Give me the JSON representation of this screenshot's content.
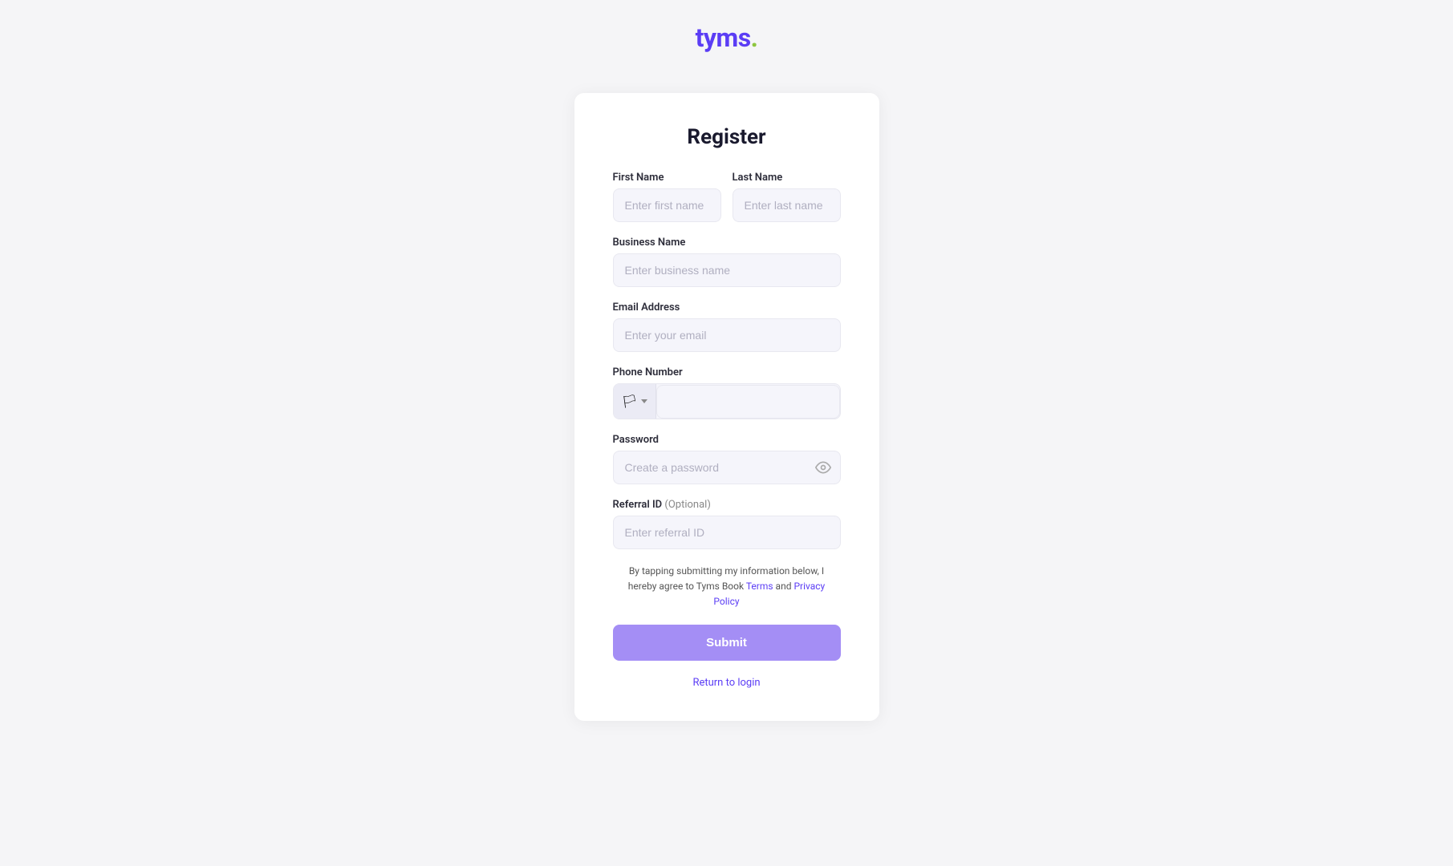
{
  "header": {
    "logo_text": "tyms",
    "logo_dot": "."
  },
  "form": {
    "title": "Register",
    "fields": {
      "first_name": {
        "label": "First Name",
        "placeholder": "Enter first name"
      },
      "last_name": {
        "label": "Last Name",
        "placeholder": "Enter last name"
      },
      "business_name": {
        "label": "Business Name",
        "placeholder": "Enter business name"
      },
      "email": {
        "label": "Email Address",
        "placeholder": "Enter your email"
      },
      "phone": {
        "label": "Phone Number",
        "placeholder": ""
      },
      "password": {
        "label": "Password",
        "placeholder": "Create a password"
      },
      "referral_id": {
        "label": "Referral ID",
        "label_optional": " (Optional)",
        "placeholder": "Enter referral ID"
      }
    },
    "consent": {
      "text_before": "By tapping submitting my information below, I hereby agree to Tyms Book ",
      "terms_label": "Terms",
      "and_text": " and ",
      "privacy_label": "Privacy Policy"
    },
    "submit_label": "Submit",
    "return_login_label": "Return to login"
  }
}
